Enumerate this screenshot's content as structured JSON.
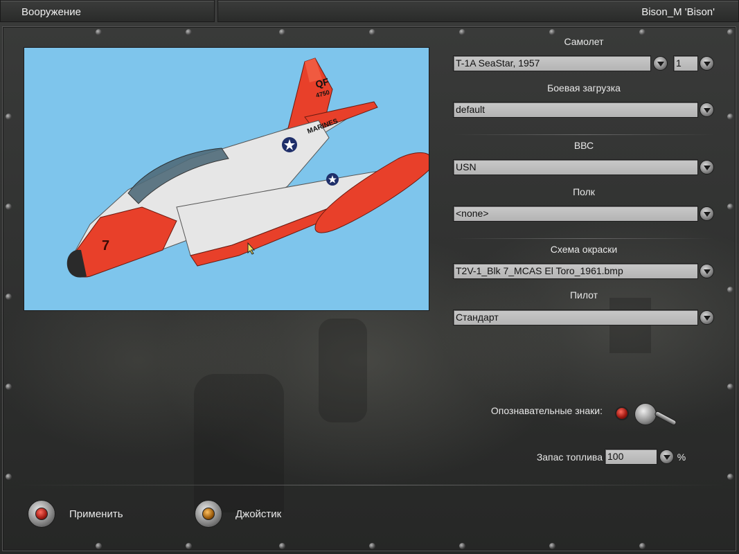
{
  "window": {
    "title_left": "Вооружение",
    "title_right": "Bison_M 'Bison'"
  },
  "aircraft": {
    "label": "Самолет",
    "value": "T-1A SeaStar, 1957",
    "count": "1"
  },
  "loadout": {
    "label": "Боевая загрузка",
    "value": "default"
  },
  "airforce": {
    "label": "ВВС",
    "value": "USN"
  },
  "regiment": {
    "label": "Полк",
    "value": "<none>"
  },
  "paint": {
    "label": "Схема окраски",
    "value": "T2V-1_Blk 7_MCAS El Toro_1961.bmp"
  },
  "pilot": {
    "label": "Пилот",
    "value": "Стандарт"
  },
  "markings": {
    "label": "Опознавательные знаки:"
  },
  "fuel": {
    "label": "Запас топлива",
    "value": "100",
    "unit": "%"
  },
  "buttons": {
    "apply": "Применить",
    "joystick": "Джойстик"
  },
  "aircraft_markings": {
    "tail_code": "QF",
    "tail_number": "4750",
    "fuselage_text": "MARINES",
    "nose_number": "7"
  },
  "colors": {
    "preview_bg": "#7ec5ec",
    "aircraft_red": "#e8402a",
    "aircraft_white": "#e6e6e6",
    "lamp_red": "#c0281c",
    "lamp_amber": "#c27a1a"
  }
}
